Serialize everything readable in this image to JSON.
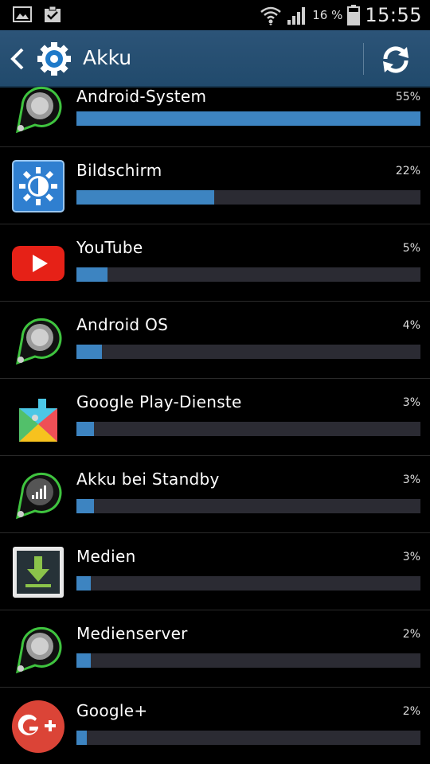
{
  "status_bar": {
    "battery_percent": "16 %",
    "time": "15:55",
    "icons": [
      "image-icon",
      "clipboard-check-icon",
      "wifi-icon",
      "signal-icon",
      "battery-icon"
    ]
  },
  "action_bar": {
    "title": "Akku",
    "icons": [
      "back-chevron-icon",
      "settings-gear-icon",
      "refresh-icon"
    ]
  },
  "colors": {
    "action_bar": "#2c5478",
    "bar_fill": "#3d84c1",
    "bar_track": "#2b2b33"
  },
  "apps": [
    {
      "name": "Android-System",
      "percent_label": "55%",
      "fraction": 1.0,
      "icon": "android-system-icon"
    },
    {
      "name": "Bildschirm",
      "percent_label": "22%",
      "fraction": 0.4,
      "icon": "brightness-icon"
    },
    {
      "name": "YouTube",
      "percent_label": "5%",
      "fraction": 0.091,
      "icon": "youtube-icon"
    },
    {
      "name": "Android OS",
      "percent_label": "4%",
      "fraction": 0.073,
      "icon": "android-os-icon"
    },
    {
      "name": "Google Play-Dienste",
      "percent_label": "3%",
      "fraction": 0.051,
      "icon": "google-play-services-icon"
    },
    {
      "name": "Akku bei Standby",
      "percent_label": "3%",
      "fraction": 0.051,
      "icon": "standby-signal-icon"
    },
    {
      "name": "Medien",
      "percent_label": "3%",
      "fraction": 0.042,
      "icon": "download-icon"
    },
    {
      "name": "Medienserver",
      "percent_label": "2%",
      "fraction": 0.042,
      "icon": "media-server-icon"
    },
    {
      "name": "Google+",
      "percent_label": "2%",
      "fraction": 0.03,
      "icon": "google-plus-icon"
    }
  ]
}
